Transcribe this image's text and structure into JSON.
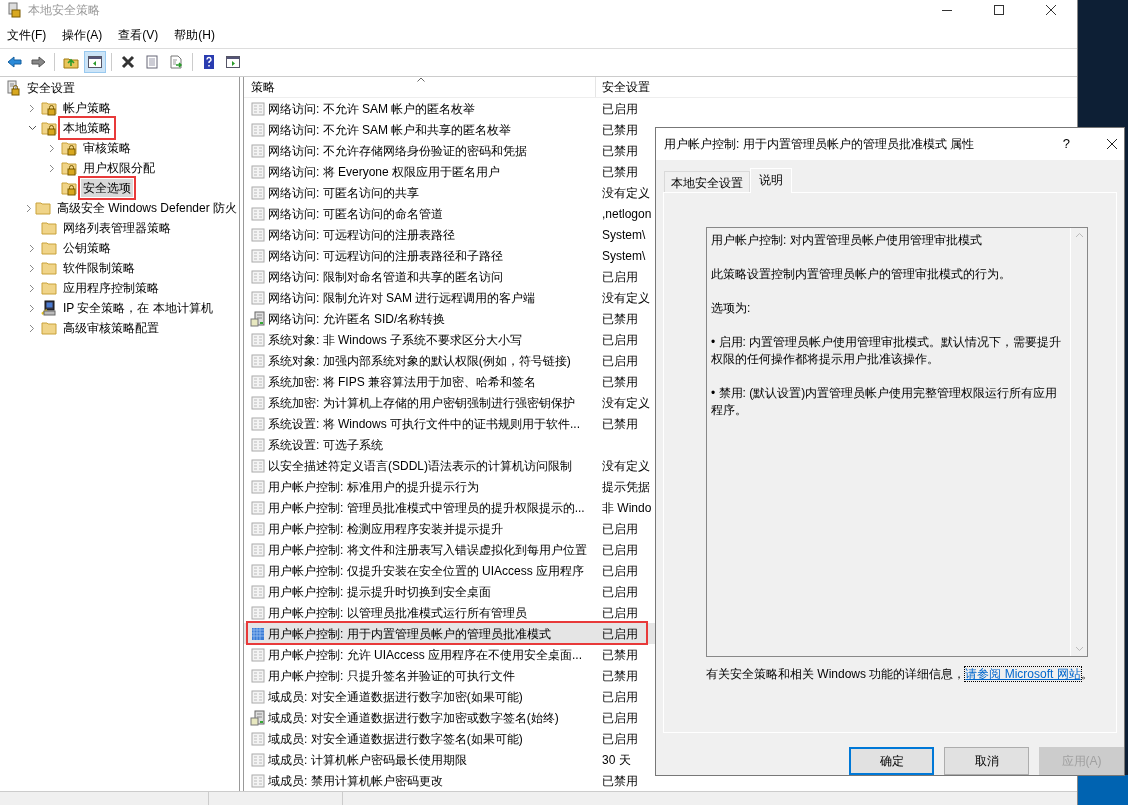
{
  "window": {
    "title": "本地安全策略"
  },
  "menu": [
    "文件(F)",
    "操作(A)",
    "查看(V)",
    "帮助(H)"
  ],
  "toolbar": [
    {
      "kind": "back",
      "pressed": false
    },
    {
      "kind": "forward",
      "pressed": false
    },
    {
      "kind": "sep"
    },
    {
      "kind": "up",
      "pressed": false
    },
    {
      "kind": "tree",
      "pressed": true
    },
    {
      "kind": "sep"
    },
    {
      "kind": "delete",
      "pressed": false
    },
    {
      "kind": "properties",
      "pressed": false
    },
    {
      "kind": "export",
      "pressed": false
    },
    {
      "kind": "sep"
    },
    {
      "kind": "help",
      "pressed": false
    },
    {
      "kind": "pane",
      "pressed": false
    }
  ],
  "tree": [
    {
      "label": "安全设置",
      "kind": "root",
      "selected": false,
      "annotated": false,
      "children": [
        {
          "label": "帐户策略",
          "kind": "secured-folder",
          "expanded": false,
          "selected": false,
          "annotated": false
        },
        {
          "label": "本地策略",
          "kind": "secured-folder",
          "expanded": true,
          "selected": false,
          "annotated": true,
          "children": [
            {
              "label": "审核策略",
              "kind": "secured-folder",
              "expanded": false,
              "selected": false,
              "annotated": false
            },
            {
              "label": "用户权限分配",
              "kind": "secured-folder",
              "expanded": false,
              "selected": false,
              "annotated": false
            },
            {
              "label": "安全选项",
              "kind": "secured-folder",
              "selected": true,
              "annotated": true
            }
          ]
        },
        {
          "label": "高级安全 Windows Defender 防火",
          "kind": "folder",
          "expanded": false,
          "selected": false,
          "annotated": false
        },
        {
          "label": "网络列表管理器策略",
          "kind": "folder",
          "selected": false,
          "annotated": false
        },
        {
          "label": "公钥策略",
          "kind": "folder",
          "expanded": false,
          "selected": false,
          "annotated": false
        },
        {
          "label": "软件限制策略",
          "kind": "folder",
          "expanded": false,
          "selected": false,
          "annotated": false
        },
        {
          "label": "应用程序控制策略",
          "kind": "folder",
          "expanded": false,
          "selected": false,
          "annotated": false
        },
        {
          "label": "IP 安全策略，在 本地计算机",
          "kind": "ip-policy",
          "expanded": false,
          "selected": false,
          "annotated": false
        },
        {
          "label": "高级审核策略配置",
          "kind": "folder",
          "expanded": false,
          "selected": false,
          "annotated": false
        }
      ]
    }
  ],
  "table": {
    "columns": [
      "策略",
      "安全设置"
    ],
    "rows": [
      {
        "policy": "网络访问: 不允许 SAM 帐户的匿名枚举",
        "setting": "已启用",
        "kind": "plain",
        "selected": false,
        "annotated": false
      },
      {
        "policy": "网络访问: 不允许 SAM 帐户和共享的匿名枚举",
        "setting": "已禁用",
        "kind": "plain",
        "selected": false,
        "annotated": false
      },
      {
        "policy": "网络访问: 不允许存储网络身份验证的密码和凭据",
        "setting": "已禁用",
        "kind": "plain",
        "selected": false,
        "annotated": false
      },
      {
        "policy": "网络访问: 将 Everyone 权限应用于匿名用户",
        "setting": "已禁用",
        "kind": "plain",
        "selected": false,
        "annotated": false
      },
      {
        "policy": "网络访问: 可匿名访问的共享",
        "setting": "没有定义",
        "kind": "plain",
        "selected": false,
        "annotated": false
      },
      {
        "policy": "网络访问: 可匿名访问的命名管道",
        "setting": ",netlogon",
        "kind": "plain",
        "selected": false,
        "annotated": false
      },
      {
        "policy": "网络访问: 可远程访问的注册表路径",
        "setting": "System\\",
        "kind": "plain",
        "selected": false,
        "annotated": false
      },
      {
        "policy": "网络访问: 可远程访问的注册表路径和子路径",
        "setting": "System\\",
        "kind": "plain",
        "selected": false,
        "annotated": false
      },
      {
        "policy": "网络访问: 限制对命名管道和共享的匿名访问",
        "setting": "已启用",
        "kind": "plain",
        "selected": false,
        "annotated": false
      },
      {
        "policy": "网络访问: 限制允许对 SAM 进行远程调用的客户端",
        "setting": "没有定义",
        "kind": "plain",
        "selected": false,
        "annotated": false
      },
      {
        "policy": "网络访问: 允许匿名 SID/名称转换",
        "setting": "已禁用",
        "kind": "server",
        "selected": false,
        "annotated": false
      },
      {
        "policy": "系统对象: 非 Windows 子系统不要求区分大小写",
        "setting": "已启用",
        "kind": "plain",
        "selected": false,
        "annotated": false
      },
      {
        "policy": "系统对象: 加强内部系统对象的默认权限(例如，符号链接)",
        "setting": "已启用",
        "kind": "plain",
        "selected": false,
        "annotated": false
      },
      {
        "policy": "系统加密: 将 FIPS 兼容算法用于加密、哈希和签名",
        "setting": "已禁用",
        "kind": "plain",
        "selected": false,
        "annotated": false
      },
      {
        "policy": "系统加密: 为计算机上存储的用户密钥强制进行强密钥保护",
        "setting": "没有定义",
        "kind": "plain",
        "selected": false,
        "annotated": false
      },
      {
        "policy": "系统设置: 将 Windows 可执行文件中的证书规则用于软件...",
        "setting": "已禁用",
        "kind": "plain",
        "selected": false,
        "annotated": false
      },
      {
        "policy": "系统设置: 可选子系统",
        "kind": "plain",
        "selected": false,
        "annotated": false
      },
      {
        "policy": "以安全描述符定义语言(SDDL)语法表示的计算机访问限制",
        "setting": "没有定义",
        "kind": "plain",
        "selected": false,
        "annotated": false
      },
      {
        "policy": "用户帐户控制: 标准用户的提升提示行为",
        "setting": "提示凭据",
        "kind": "plain",
        "selected": false,
        "annotated": false
      },
      {
        "policy": "用户帐户控制: 管理员批准模式中管理员的提升权限提示的...",
        "setting": "非 Windo",
        "kind": "plain",
        "selected": false,
        "annotated": false
      },
      {
        "policy": "用户帐户控制: 检测应用程序安装并提示提升",
        "setting": "已启用",
        "kind": "plain",
        "selected": false,
        "annotated": false
      },
      {
        "policy": "用户帐户控制: 将文件和注册表写入错误虚拟化到每用户位置",
        "setting": "已启用",
        "kind": "plain",
        "selected": false,
        "annotated": false
      },
      {
        "policy": "用户帐户控制: 仅提升安装在安全位置的 UIAccess 应用程序",
        "setting": "已启用",
        "kind": "plain",
        "selected": false,
        "annotated": false
      },
      {
        "policy": "用户帐户控制: 提示提升时切换到安全桌面",
        "setting": "已启用",
        "kind": "plain",
        "selected": false,
        "annotated": false
      },
      {
        "policy": "用户帐户控制: 以管理员批准模式运行所有管理员",
        "setting": "已启用",
        "kind": "plain",
        "selected": false,
        "annotated": false
      },
      {
        "policy": "用户帐户控制: 用于内置管理员帐户的管理员批准模式",
        "setting": "已启用",
        "kind": "active",
        "selected": true,
        "annotated": true
      },
      {
        "policy": "用户帐户控制: 允许 UIAccess 应用程序在不使用安全桌面...",
        "setting": "已禁用",
        "kind": "plain",
        "selected": false,
        "annotated": false
      },
      {
        "policy": "用户帐户控制: 只提升签名并验证的可执行文件",
        "setting": "已禁用",
        "kind": "plain",
        "selected": false,
        "annotated": false
      },
      {
        "policy": "域成员: 对安全通道数据进行数字加密(如果可能)",
        "setting": "已启用",
        "kind": "plain",
        "selected": false,
        "annotated": false
      },
      {
        "policy": "域成员: 对安全通道数据进行数字加密或数字签名(始终)",
        "setting": "已启用",
        "kind": "server",
        "selected": false,
        "annotated": false
      },
      {
        "policy": "域成员: 对安全通道数据进行数字签名(如果可能)",
        "setting": "已启用",
        "kind": "plain",
        "selected": false,
        "annotated": false
      },
      {
        "policy": "域成员: 计算机帐户密码最长使用期限",
        "setting": "30 天",
        "kind": "plain",
        "selected": false,
        "annotated": false
      },
      {
        "policy": "域成员: 禁用计算机帐户密码更改",
        "setting": "已禁用",
        "kind": "plain",
        "selected": false,
        "annotated": false
      }
    ]
  },
  "dialog": {
    "title": "用户帐户控制: 用于内置管理员帐户的管理员批准模式 属性",
    "help": "?",
    "tabs": [
      {
        "label": "本地安全设置",
        "selected": false
      },
      {
        "label": "说明",
        "selected": true
      }
    ],
    "description": [
      "用户帐户控制: 对内置管理员帐户使用管理审批模式",
      "此策略设置控制内置管理员帐户的管理审批模式的行为。",
      "选项为:",
      "• 启用: 内置管理员帐户使用管理审批模式。默认情况下，需要提升权限的任何操作都将提示用户批准该操作。",
      "• 禁用: (默认设置)内置管理员帐户使用完整管理权限运行所有应用程序。"
    ],
    "info_text": "有关安全策略和相关 Windows 功能的详细信息，",
    "info_link": "请参阅 Microsoft 网站",
    "info_end": "。",
    "buttons": [
      {
        "label": "确定",
        "default": true,
        "disabled": false
      },
      {
        "label": "取消",
        "default": false,
        "disabled": false
      },
      {
        "label": "应用(A)",
        "default": false,
        "disabled": true
      }
    ]
  }
}
